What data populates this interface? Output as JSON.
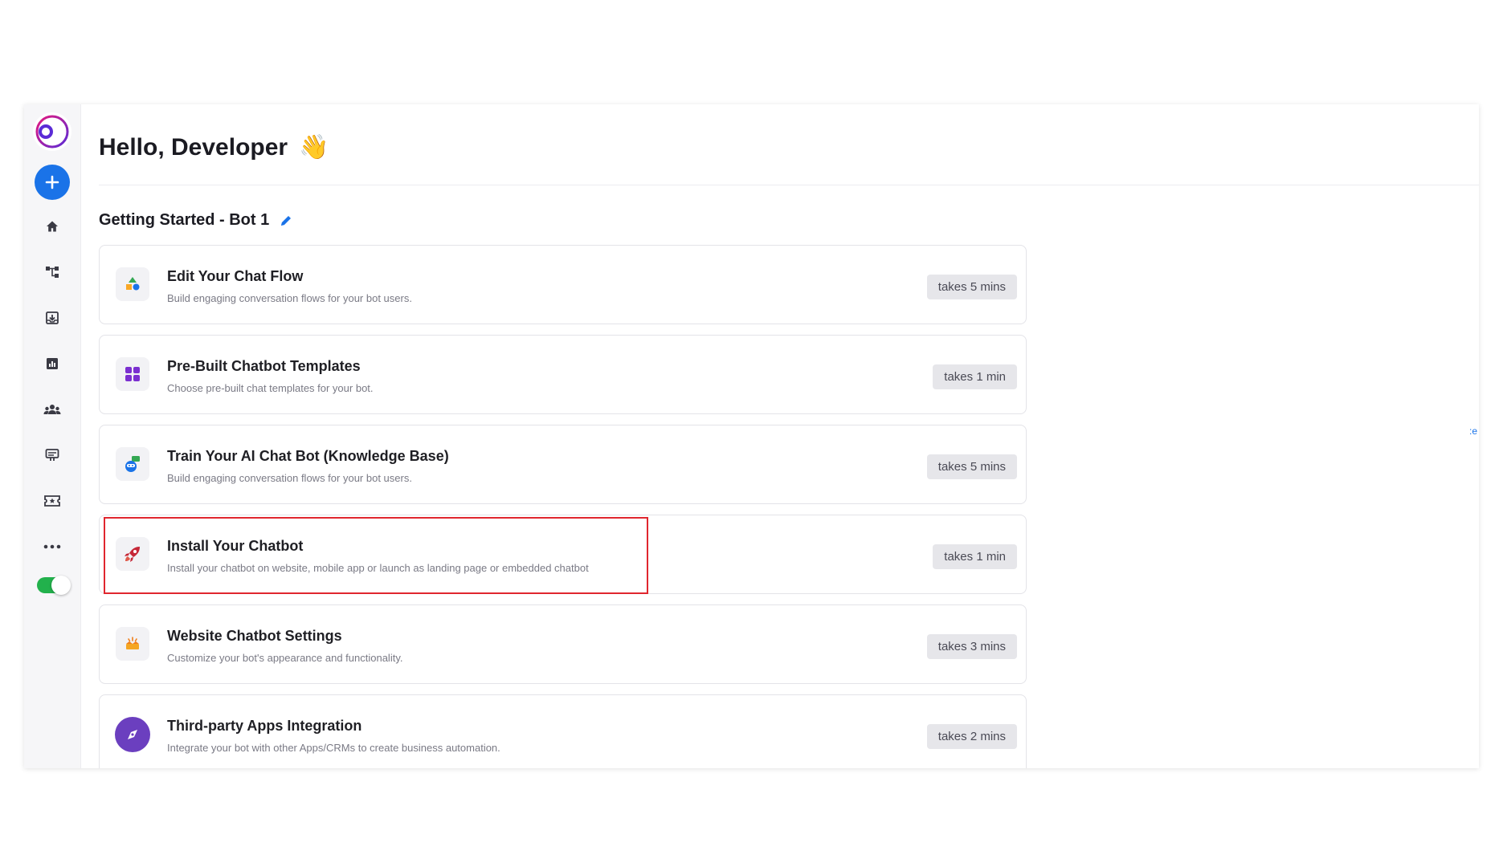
{
  "header": {
    "greeting": "Hello, Developer",
    "wave_emoji": "👋"
  },
  "section": {
    "title": "Getting Started - Bot 1"
  },
  "sidebar": {
    "items": [
      {
        "icon": "home-icon"
      },
      {
        "icon": "flow-icon"
      },
      {
        "icon": "inbox-icon"
      },
      {
        "icon": "analytics-icon"
      },
      {
        "icon": "users-icon"
      },
      {
        "icon": "broadcast-icon"
      },
      {
        "icon": "ticket-icon"
      },
      {
        "icon": "more-icon"
      }
    ],
    "toggle_on": true
  },
  "cards": [
    {
      "title": "Edit Your Chat Flow",
      "desc": "Build engaging conversation flows for your bot users.",
      "time": "takes 5 mins",
      "icon": "shapes-icon"
    },
    {
      "title": "Pre-Built Chatbot Templates",
      "desc": "Choose pre-built chat templates for your bot.",
      "time": "takes 1 min",
      "icon": "grid-icon"
    },
    {
      "title": "Train Your AI Chat Bot (Knowledge Base)",
      "desc": "Build engaging conversation flows for your bot users.",
      "time": "takes 5 mins",
      "icon": "chat-bot-icon"
    },
    {
      "title": "Install Your Chatbot",
      "desc": "Install your chatbot on website, mobile app or launch as landing page or embedded chatbot",
      "time": "takes 1 min",
      "icon": "rocket-icon"
    },
    {
      "title": "Website Chatbot Settings",
      "desc": "Customize your bot's appearance and functionality.",
      "time": "takes 3 mins",
      "icon": "crown-icon"
    },
    {
      "title": "Third-party Apps Integration",
      "desc": "Integrate your bot with other Apps/CRMs to create business automation.",
      "time": "takes 2 mins",
      "icon": "compass-icon"
    }
  ],
  "colors": {
    "accent": "#1a73e8",
    "highlight": "#e0262e",
    "toggle": "#22b14c"
  }
}
